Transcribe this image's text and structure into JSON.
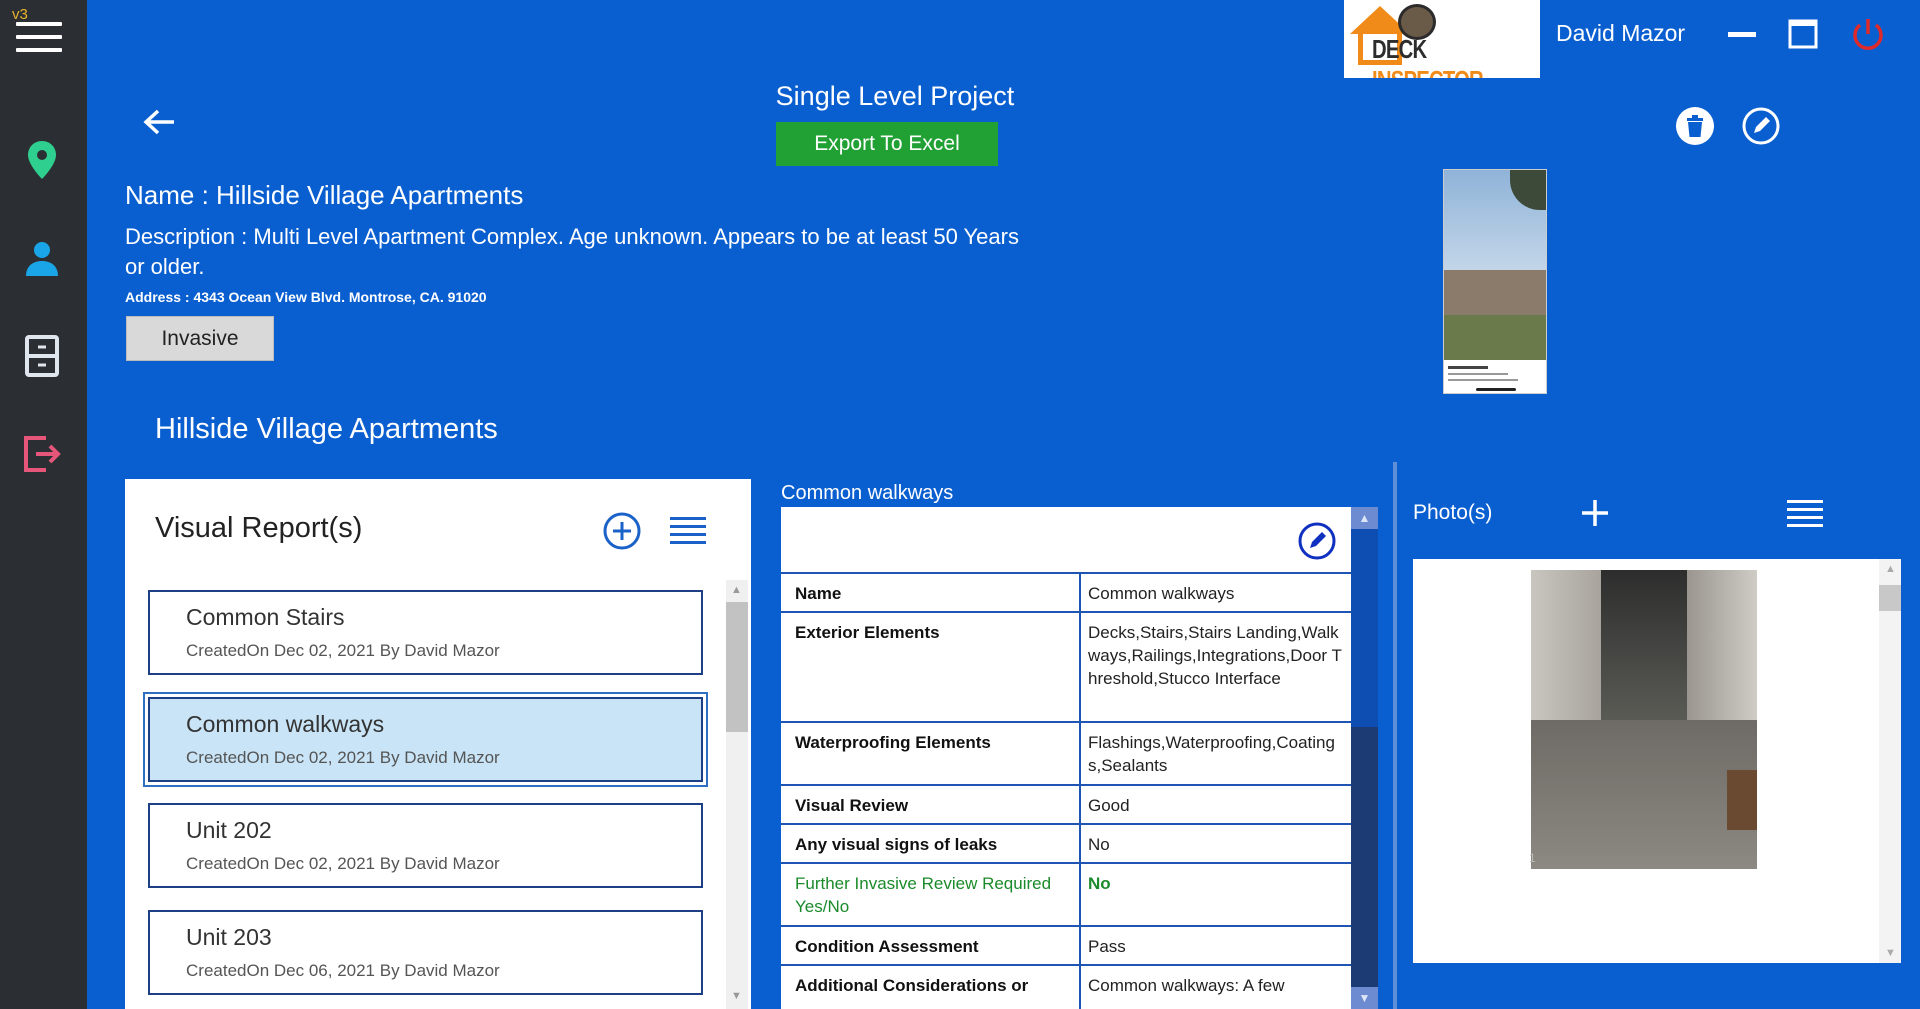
{
  "app": {
    "version": "v3",
    "brand_text_1": "DECK",
    "brand_text_2": "INSPECTOR",
    "user_name": "David  Mazor"
  },
  "project": {
    "title": "Single Level Project",
    "export_label": "Export To Excel",
    "name_line": "Name : Hillside  Village Apartments",
    "description_line": "Description : Multi Level Apartment Complex.    Age unknown.  Appears to be at least 50 Years or older.",
    "address_line": "Address : 4343 Ocean View Blvd. Montrose,  CA.  91020",
    "type_button": "Invasive",
    "section_title": "Hillside  Village Apartments"
  },
  "visual_reports": {
    "title": "Visual Report(s)",
    "items": [
      {
        "title": "Common Stairs",
        "subtitle": "CreatedOn Dec 02, 2021   By David  Mazor"
      },
      {
        "title": "Common walkways",
        "subtitle": "CreatedOn Dec 02, 2021   By David  Mazor"
      },
      {
        "title": "Unit 202",
        "subtitle": "CreatedOn Dec 02, 2021   By David  Mazor"
      },
      {
        "title": "Unit 203",
        "subtitle": "CreatedOn Dec 06, 2021   By David  Mazor"
      }
    ],
    "selected_index": 1
  },
  "details": {
    "header": "Common walkways",
    "rows": [
      {
        "key": "Name",
        "value": "Common walkways"
      },
      {
        "key": "Exterior Elements",
        "value": "Decks,Stairs,Stairs Landing,Walkways,Railings,Integrations,Door Threshold,Stucco Interface"
      },
      {
        "key": "Waterproofing Elements",
        "value": "Flashings,Waterproofing,Coatings,Sealants"
      },
      {
        "key": "Visual Review",
        "value": "Good"
      },
      {
        "key": "Any visual signs of leaks",
        "value": "No"
      },
      {
        "key": "Further Invasive Review Required Yes/No",
        "value": "No"
      },
      {
        "key": "Condition Assessment",
        "value": "Pass"
      },
      {
        "key": "Additional Considerations or",
        "value": "Common walkways:  A few"
      }
    ]
  },
  "photos": {
    "title": "Photo(s)",
    "index_label": "1"
  },
  "colors": {
    "background": "#0a5fd0",
    "rail": "#2b2f33",
    "export_green": "#21a033",
    "accent_blue": "#1f54b4",
    "selected_card": "#c8e4f6"
  }
}
